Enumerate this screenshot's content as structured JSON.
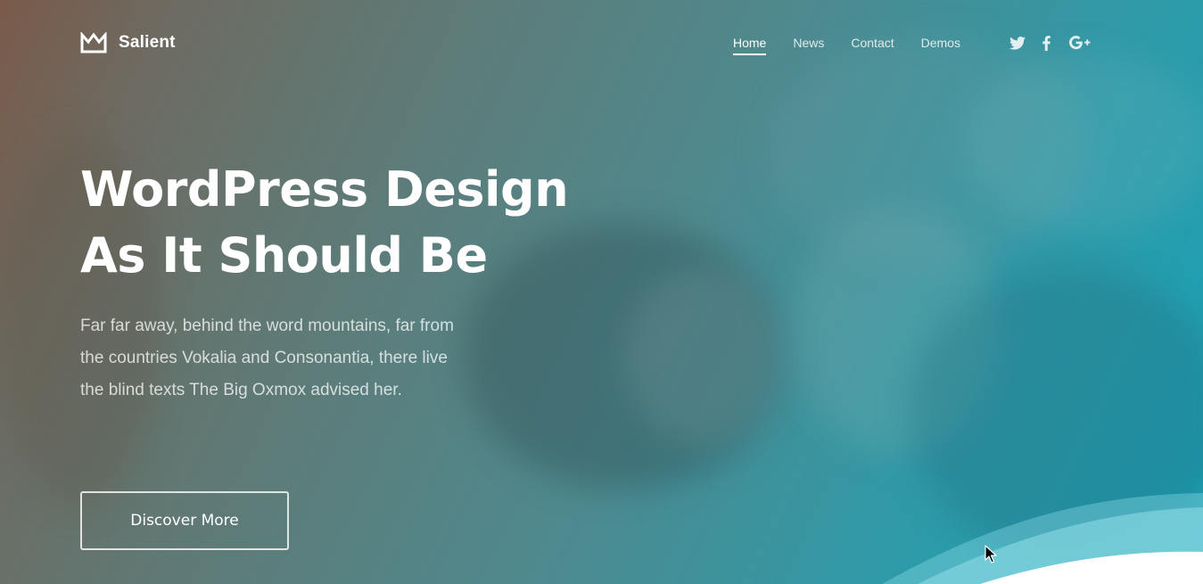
{
  "brand": {
    "logo_icon": "crown-icon",
    "name": "Salient"
  },
  "nav": {
    "items": [
      {
        "label": "Home",
        "active": true
      },
      {
        "label": "News",
        "active": false
      },
      {
        "label": "Contact",
        "active": false
      },
      {
        "label": "Demos",
        "active": false
      }
    ]
  },
  "social": [
    {
      "icon": "twitter-icon"
    },
    {
      "icon": "facebook-icon"
    },
    {
      "icon": "google-plus-icon"
    }
  ],
  "hero": {
    "title_line1": "WordPress Design",
    "title_line2": "As It Should Be",
    "description": "Far far away, behind the word mountains, far from the countries Vokalia and Consonantia, there live the blind texts The Big Oxmox advised her.",
    "cta_label": "Discover More"
  },
  "colors": {
    "gradient_start": "#7a5a4a",
    "gradient_end": "#17a3b8",
    "text": "#ffffff",
    "wave_light": "#7fd3de",
    "wave_white": "#ffffff"
  }
}
